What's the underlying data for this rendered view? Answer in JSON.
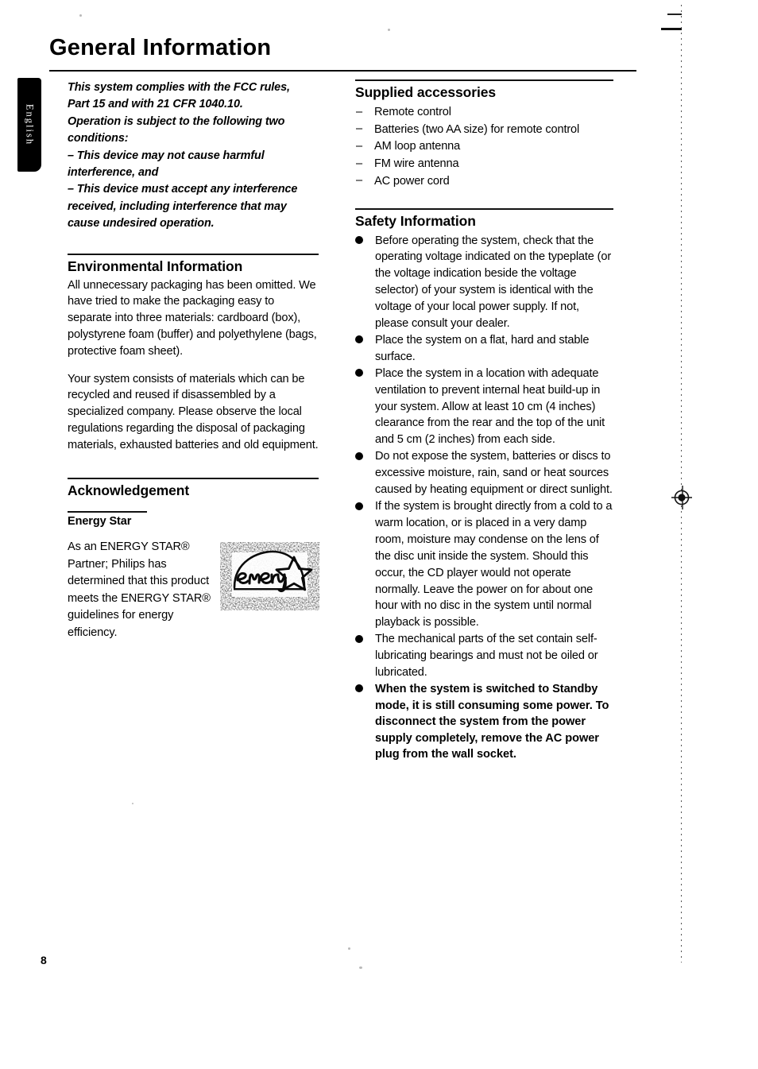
{
  "document": {
    "page_title": "General Information",
    "page_number": "8",
    "language_tab": "English"
  },
  "left_column": {
    "fcc_notice": [
      "This system complies with the FCC rules,",
      "Part 15 and with 21 CFR 1040.10.",
      "Operation is subject to the following two",
      "conditions:",
      "–  This device may not cause harmful",
      "interference, and",
      "–  This device must accept any interference",
      "received, including interference that may",
      "cause undesired operation."
    ],
    "environmental": {
      "heading": "Environmental Information",
      "paragraph_1": "All unnecessary packaging has been omitted. We have tried to make the packaging easy to separate into three materials: cardboard (box), polystyrene foam (buffer) and polyethylene (bags, protective foam sheet).",
      "paragraph_2": "Your system consists of materials which can be recycled and reused if disassembled by a specialized company. Please observe the local regulations regarding the disposal of packaging materials, exhausted batteries and old equipment."
    },
    "acknowledgement": {
      "heading": "Acknowledgement",
      "subheading": "Energy Star",
      "paragraph": "As an ENERGY STAR® Partner; Philips has determined that this product meets the ENERGY STAR® guidelines for energy efficiency.",
      "logo_word": "energy"
    }
  },
  "right_column": {
    "supplied_accessories": {
      "heading": "Supplied accessories",
      "dash": "–",
      "items": [
        "Remote control",
        "Batteries (two AA size) for remote control",
        "AM loop antenna",
        "FM wire antenna",
        "AC power cord"
      ]
    },
    "safety_information": {
      "heading": "Safety Information",
      "items": [
        {
          "text": "Before operating the system, check that the operating voltage indicated on the typeplate (or the voltage indication beside the voltage selector) of your system is identical with the voltage of your local power supply. If not, please consult your dealer.",
          "emphasis": false
        },
        {
          "text": "Place the system on a flat, hard and stable surface.",
          "emphasis": false
        },
        {
          "text": "Place the system in a location with adequate ventilation to prevent internal heat build-up in your system.  Allow at least 10 cm (4 inches) clearance from the rear and the top of the unit and 5 cm (2 inches) from each side.",
          "emphasis": false
        },
        {
          "text": "Do not expose the system, batteries or discs to excessive moisture, rain, sand or heat sources caused by heating equipment or direct sunlight.",
          "emphasis": false
        },
        {
          "text": "If the system is brought directly from a cold to a warm location, or is placed in a very damp room, moisture may condense on the lens of the disc unit inside the system. Should this occur, the CD player would not operate normally. Leave the power on for about one hour with no disc in the system until normal playback is possible.",
          "emphasis": false
        },
        {
          "text": "The mechanical parts of the set contain self-lubricating bearings and must not be oiled or lubricated.",
          "emphasis": false
        },
        {
          "text": "When the system is switched to Standby mode, it is still consuming some power. To disconnect the system from the power supply completely, remove the AC power plug from the wall socket.",
          "emphasis": true
        }
      ]
    }
  }
}
